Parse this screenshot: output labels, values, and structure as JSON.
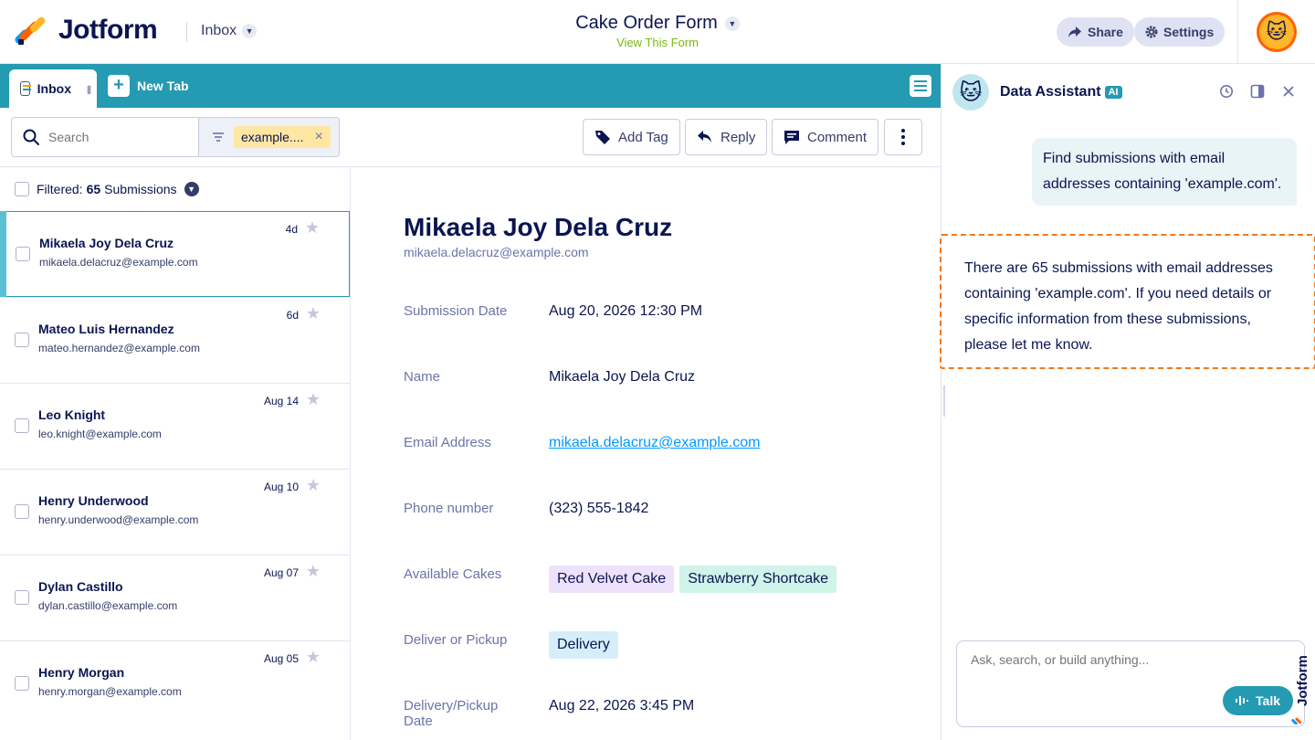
{
  "header": {
    "brand": "Jotform",
    "inbox_label": "Inbox",
    "form_title": "Cake Order Form",
    "view_link": "View This Form",
    "share_label": "Share",
    "settings_label": "Settings"
  },
  "tabs": {
    "inbox_tab": "Inbox",
    "new_tab": "New Tab"
  },
  "toolbar": {
    "search_placeholder": "Search",
    "filter_chip": "example....",
    "add_tag": "Add Tag",
    "reply": "Reply",
    "comment": "Comment"
  },
  "list": {
    "filtered_prefix": "Filtered:",
    "count": "65",
    "submissions_suffix": "Submissions",
    "items": [
      {
        "name": "Mikaela Joy Dela Cruz",
        "email": "mikaela.delacruz@example.com",
        "date": "4d"
      },
      {
        "name": "Mateo Luis Hernandez",
        "email": "mateo.hernandez@example.com",
        "date": "6d"
      },
      {
        "name": "Leo Knight",
        "email": "leo.knight@example.com",
        "date": "Aug 14"
      },
      {
        "name": "Henry Underwood",
        "email": "henry.underwood@example.com",
        "date": "Aug 10"
      },
      {
        "name": "Dylan Castillo",
        "email": "dylan.castillo@example.com",
        "date": "Aug 07"
      },
      {
        "name": "Henry Morgan",
        "email": "henry.morgan@example.com",
        "date": "Aug 05"
      }
    ]
  },
  "detail": {
    "name": "Mikaela Joy Dela Cruz",
    "email": "mikaela.delacruz@example.com",
    "fields": {
      "submission_date_label": "Submission Date",
      "submission_date_value": "Aug 20, 2026 12:30 PM",
      "name_label": "Name",
      "name_value": "Mikaela Joy Dela Cruz",
      "email_label": "Email Address",
      "email_value": "mikaela.delacruz@example.com",
      "phone_label": "Phone number",
      "phone_value": "(323) 555-1842",
      "cakes_label": "Available Cakes",
      "cake_1": "Red Velvet Cake",
      "cake_2": "Strawberry Shortcake",
      "delivery_label": "Deliver or Pickup",
      "delivery_value": "Delivery",
      "pickup_date_label": "Delivery/Pickup Date",
      "pickup_date_value": "Aug 22, 2026 3:45 PM"
    },
    "tag_colors": {
      "cake_1": "#ede1fb",
      "cake_2": "#d0f3ea",
      "delivery": "#d6eefa"
    }
  },
  "assistant": {
    "title": "Data Assistant",
    "badge": "AI",
    "user_message": "Find submissions with email addresses containing 'example.com'.",
    "bot_message": "There are 65 submissions with email addresses containing 'example.com'. If you need details or specific information from these submissions, please let me know.",
    "input_placeholder": "Ask, search, or build anything...",
    "talk_label": "Talk"
  },
  "colors": {
    "accent": "#259ab3",
    "brand_navy": "#0a1551",
    "view_link": "#78bb07",
    "highlight_border": "#f07820"
  }
}
